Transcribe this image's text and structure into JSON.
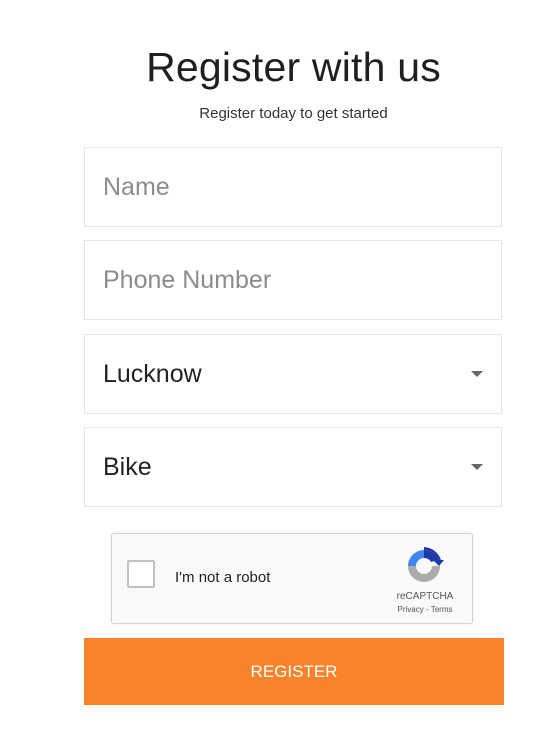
{
  "header": {
    "title": "Register with us",
    "subtitle": "Register today to get started"
  },
  "form": {
    "name_placeholder": "Name",
    "phone_placeholder": "Phone Number",
    "city_selected": "Lucknow",
    "vehicle_selected": "Bike"
  },
  "recaptcha": {
    "label": "I'm not a robot",
    "brand": "reCAPTCHA",
    "privacy": "Privacy",
    "separator": " - ",
    "terms": "Terms"
  },
  "actions": {
    "register_label": "REGISTER"
  },
  "colors": {
    "accent": "#f7832d"
  }
}
